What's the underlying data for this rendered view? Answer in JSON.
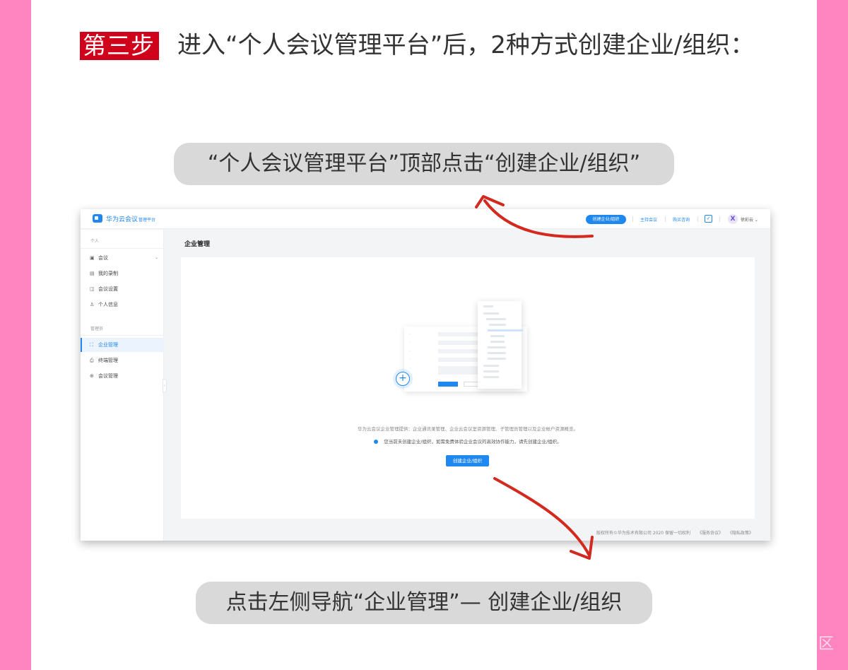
{
  "colors": {
    "accent": "#1f87f0",
    "step_badge": "#d0021b",
    "border_pink": "#ff85c0",
    "arrow": "#d22a1e"
  },
  "step": {
    "badge": "第三步",
    "text": "进入“个人会议管理平台”后，2种方式创建企业/组织："
  },
  "callouts": {
    "top": "“个人会议管理平台”顶部点击“创建企业/组织”",
    "bottom": "点击左侧导航“企业管理”— 创建企业/组织"
  },
  "watermark": "区",
  "app": {
    "logo": {
      "name": "华为云会议",
      "sub": "管理平台",
      "icon": "video-camera-icon"
    },
    "topbar": {
      "create_button": "创建企业/组织",
      "links": [
        "主持会议",
        "购买咨询"
      ],
      "check_icon": "check-square-icon",
      "avatar_letter": "X",
      "user_name": "徐彩云 ⌄"
    },
    "sidebar": {
      "personal_section": "个人",
      "personal_items": [
        {
          "icon": "calendar-icon",
          "glyph": "▣",
          "label": "会议"
        },
        {
          "icon": "recording-icon",
          "glyph": "▤",
          "label": "我的录制"
        },
        {
          "icon": "settings-icon",
          "glyph": "◫",
          "label": "会议设置"
        },
        {
          "icon": "user-icon",
          "glyph": "♙",
          "label": "个人信息"
        }
      ],
      "admin_section": "管理员",
      "admin_items": [
        {
          "icon": "enterprise-icon",
          "glyph": "⛶",
          "label": "企业管理",
          "active": true
        },
        {
          "icon": "terminal-icon",
          "glyph": "⎙",
          "label": "终端管理"
        },
        {
          "icon": "meeting-admin-icon",
          "glyph": "⊕",
          "label": "会议管理"
        }
      ],
      "collapse_glyph": "‹"
    },
    "main": {
      "title": "企业管理",
      "description": "华为云会议企业管理提供：企业通讯录管理、企业云会议室资源管理、子管理员管理以及企业帐户资源概览。",
      "notice": "您当前未创建企业/组织，如需免费体验企业会议的高效协作能力，请先创建企业/组织。",
      "create_button": "创建企业/组织",
      "plus_glyph": "+"
    },
    "footer": {
      "copyright": "版权所有©华为技术有限公司 2020 保留一切权利",
      "links": [
        "《服务协议》",
        "《隐私政策》"
      ]
    }
  }
}
